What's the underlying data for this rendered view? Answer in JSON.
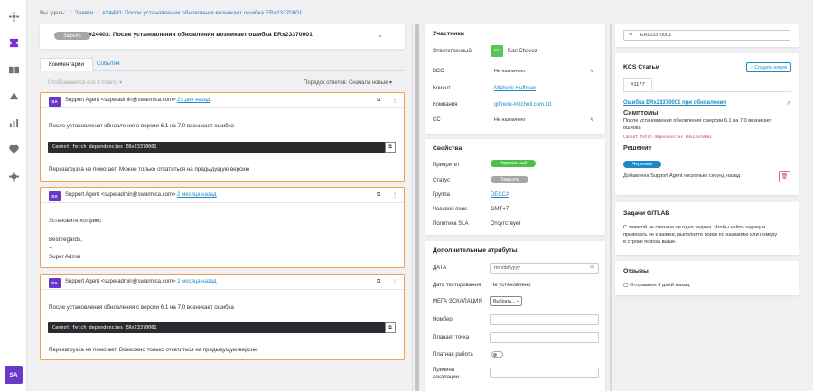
{
  "breadcrumb": {
    "prefix": "Вы здесь:",
    "root": "Заявки",
    "current": "#24403: После установления обновления возникает ошибка ERx23370001"
  },
  "ticket": {
    "state": "Закрыта",
    "title": "#24403: После установления обновления возникает ошибка ERx23370001",
    "chevron": "⌄"
  },
  "tabs": [
    {
      "label": "Комментарии"
    },
    {
      "label": "События"
    }
  ],
  "comments_meta": {
    "show_all": "Отображаются все 3 ответа ▾",
    "sort": "Порядок ответов: Сначала новые ▾"
  },
  "comments": [
    {
      "initials": "SA",
      "author": "Support Agent  <superadmin@swarmica.com>",
      "time": "23 дня назад",
      "lines": [
        "После установления обновления с версии 6.1 на 7.0 возникает ошибка"
      ],
      "code": "Cannot fetch dependencies ERx23370001",
      "after": [
        "Перезагрузка не помогает. Можно только откатиться на предыдущую версию"
      ]
    },
    {
      "initials": "SA",
      "author": "Support Agent  <superadmin@swarmica.com>",
      "time": "2 месяца назад",
      "lines": [
        "Установите хотфикс",
        "Best regards,",
        "--",
        "Super Admin"
      ]
    },
    {
      "initials": "SA",
      "author": "Support Agent  <superadmin@swarmica.com>",
      "time": "2 месяца назад",
      "lines": [
        "После установления обновления с версии 6.1 на 7.0 возникает ошибка"
      ],
      "code": "Cannot fetch dependencies ERx23370001",
      "after": [
        "Перезагрузка не помогает.  Возможно только откатиться на предыдущую версию"
      ]
    }
  ],
  "participants": {
    "title": "Участники",
    "rows": [
      {
        "label": "Ответственный",
        "value": "Kari Chavez",
        "avatar": "KC"
      },
      {
        "label": "ВСС",
        "value": "Не назначено"
      },
      {
        "label": "Клиент",
        "value": "Michelle Huffman"
      },
      {
        "label": "Компания",
        "value": "gilmore-mitchell.com.ltd"
      },
      {
        "label": "CC",
        "value": "Не назначено"
      }
    ],
    "edit_icon": "pencil-icon"
  },
  "properties": {
    "title": "Свойства",
    "rows": [
      {
        "label": "Приоритет",
        "value": "Нормальный",
        "color": "#4cc04c"
      },
      {
        "label": "Статус",
        "value": "Закрыта",
        "color": "#a6a6a6"
      },
      {
        "label": "Группа",
        "value": "DECCA"
      },
      {
        "label": "Часовой пояс",
        "value": "GMT+7"
      },
      {
        "label": "Политика SLA",
        "value": "Отсутствует"
      }
    ]
  },
  "attributes": {
    "title": "Дополнительные атрибуты",
    "date_label": "ДАТА",
    "date_placeholder": "mm/dd/yyyy",
    "test_date_label": "Дата тестирования",
    "test_date_value": "Не установлено",
    "escalation_label": "МЕГА ЭСКАЛАЦИЯ",
    "escalation_value": "Выбрать...",
    "number_label": "Номбер",
    "float_label": "Плавает точка",
    "paid_label": "Платная работа",
    "reason_label_1": "Причина",
    "reason_label_2": "эскалации"
  },
  "search": {
    "value": "ERx23370001"
  },
  "kcs": {
    "title": "KCS Статьи",
    "create": "+ Создать новую",
    "tab": "#1177",
    "article_link": "Ошибка ERx23370001 при обновлении",
    "symptoms_h": "Симптомы",
    "symptoms_1": "После установления обновления с версии 6.1 на 7.0 возникает",
    "symptoms_2": "ошибка",
    "code": "Cannot fetch dependencies ERx23370001",
    "solution_h": "Решение",
    "badge": "Черновик",
    "added": "Добавлена Support Agent несколько секунд назад",
    "badge_color": "#1f88c8"
  },
  "gitlab": {
    "title": "Задачи GITLAB",
    "line1": "С заявкой не связана ни одна задача. Чтобы найти задачу и",
    "line2": "привязать ее к заявке, выполните поиск по названию или номеру",
    "line3": "в строке поиска выше."
  },
  "views": {
    "title": "Отзывы",
    "sent": "Отправлен 9 дней назад"
  },
  "user": {
    "initials": "SA"
  },
  "colors": {
    "accent": "#6a38c9",
    "link": "#1f88c8",
    "comment_border": "#f0a24a"
  }
}
